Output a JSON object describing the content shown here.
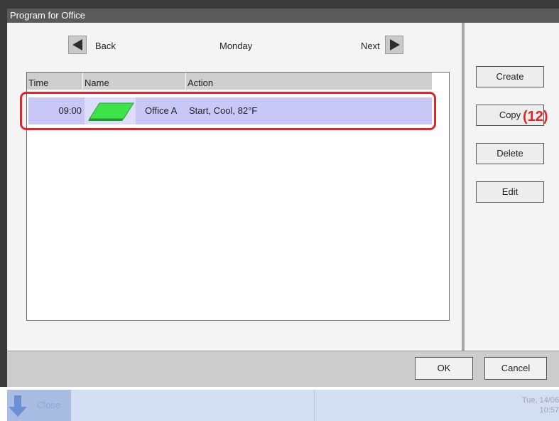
{
  "window": {
    "title": "Program for Office"
  },
  "nav": {
    "back_label": "Back",
    "day": "Monday",
    "next_label": "Next"
  },
  "table": {
    "headers": [
      "Time",
      "Name",
      "Action"
    ],
    "rows": [
      {
        "time": "09:00",
        "name": "Office A",
        "action": "Start, Cool, 82°F",
        "icon": "area-tile-icon"
      }
    ]
  },
  "side_buttons": {
    "create": "Create",
    "copy": "Copy",
    "delete": "Delete",
    "edit": "Edit"
  },
  "annotation": {
    "callout": "(12)"
  },
  "footer": {
    "ok": "OK",
    "cancel": "Cancel"
  },
  "taskbar": {
    "close_label": "Close",
    "date": "Tue, 14/06",
    "time": "10:57"
  },
  "colors": {
    "selected_row": "#c9c7f5",
    "highlight": "#e0262b",
    "icon_green": "#3ee24a"
  }
}
